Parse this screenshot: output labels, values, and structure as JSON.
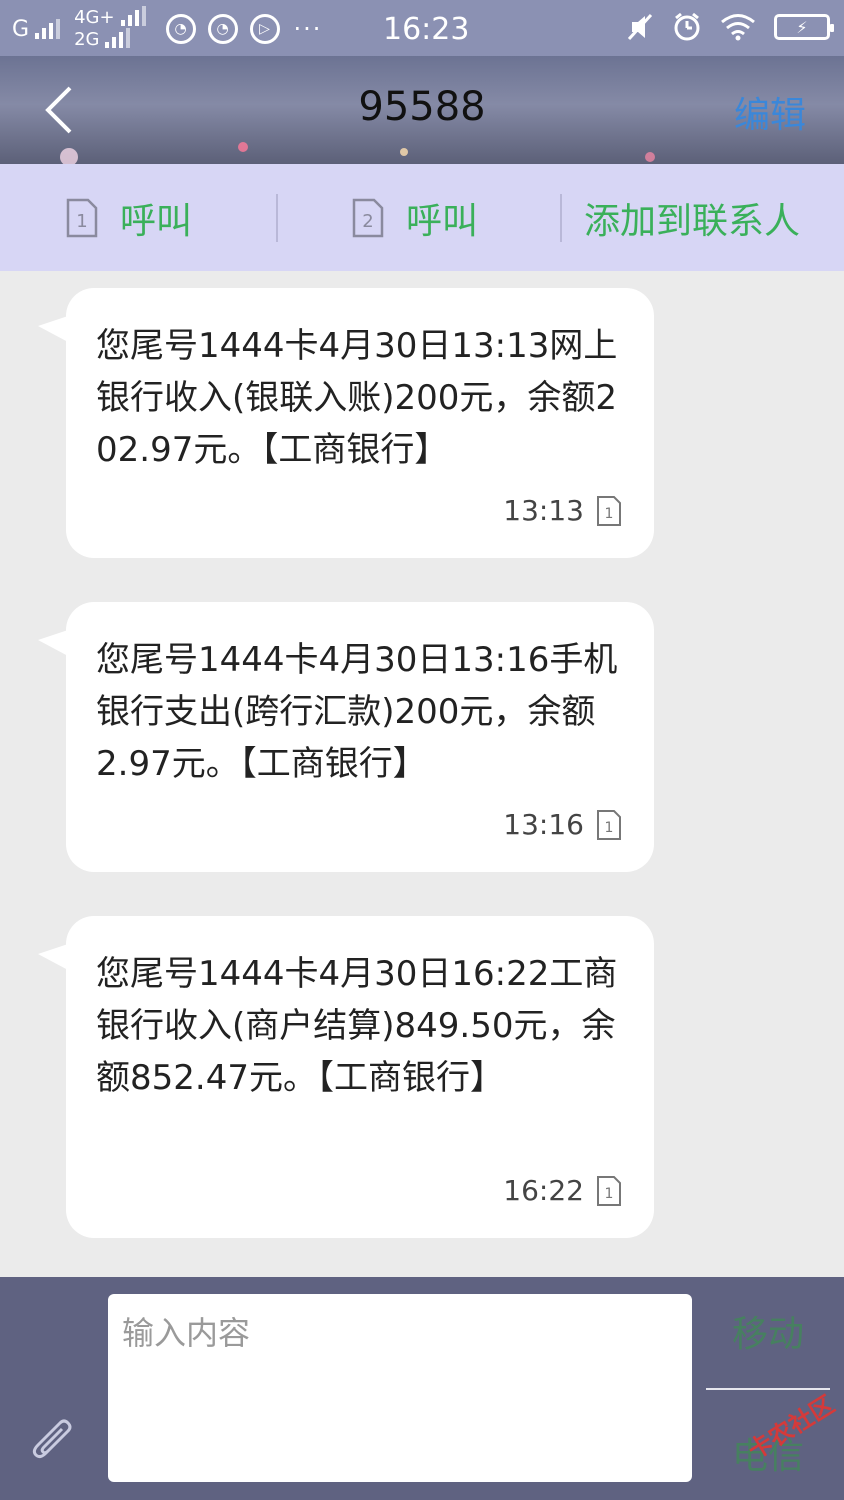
{
  "status_bar": {
    "network_1": "G",
    "network_2_top": "4G+",
    "network_2_bottom": "2G",
    "dots": "···",
    "time": "16:23",
    "battery_glyph": "⚡"
  },
  "header": {
    "title": "95588",
    "edit_label": "编辑"
  },
  "actions": {
    "call_sim1_label": "呼叫",
    "call_sim1_sim": "1",
    "call_sim2_label": "呼叫",
    "call_sim2_sim": "2",
    "add_contact_label": "添加到联系人"
  },
  "messages": [
    {
      "text": "您尾号1444卡4月30日13:13网上银行收入(银联入账)200元，余额202.97元。【工商银行】",
      "time": "13:13",
      "sim": "1"
    },
    {
      "text": "您尾号1444卡4月30日13:16手机银行支出(跨行汇款)200元，余额2.97元。【工商银行】",
      "time": "13:16",
      "sim": "1"
    },
    {
      "text": "您尾号1444卡4月30日16:22工商银行收入(商户结算)849.50元，余额852.47元。【工商银行】",
      "time": "16:22",
      "sim": "1"
    }
  ],
  "composer": {
    "placeholder": "输入内容",
    "send_sim1_label": "移动",
    "send_sim2_label": "电信"
  },
  "watermark": "卡农社区",
  "colors": {
    "accent_green": "#3ab05a",
    "edit_blue": "#3b87d9",
    "action_bar_bg": "#d7d6f5",
    "input_bar_bg": "#5f6281"
  }
}
